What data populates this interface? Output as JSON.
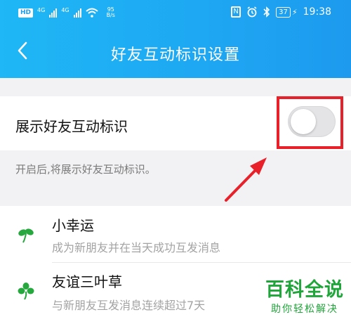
{
  "status": {
    "hd_badge": "HD",
    "signal_1_label": "4G",
    "signal_2_label": "4G",
    "net_speed_value": "95",
    "net_speed_unit": "B/s",
    "nfc_label": "N",
    "battery": "37",
    "time": "19:38"
  },
  "nav": {
    "title": "好友互动标识设置"
  },
  "setting": {
    "label": "展示好友互动标识",
    "toggle_on": false,
    "hint": "开启后,将展示好友互动标识。"
  },
  "items": [
    {
      "title": "小幸运",
      "desc": "成为新朋友并在当天成功互发消息",
      "icon": "two-leaf-sprout-icon"
    },
    {
      "title": "友谊三叶草",
      "desc": "与新朋友互发消息连续超过7天",
      "icon": "three-leaf-clover-icon"
    }
  ],
  "colors": {
    "header_start": "#1fb7f5",
    "header_end": "#1d9aee",
    "highlight": "#e8202a",
    "leaf_green": "#27a83e",
    "watermark_green": "#1fa53a"
  },
  "watermark": {
    "main": "百科全说",
    "sub": "助你轻松解决"
  }
}
